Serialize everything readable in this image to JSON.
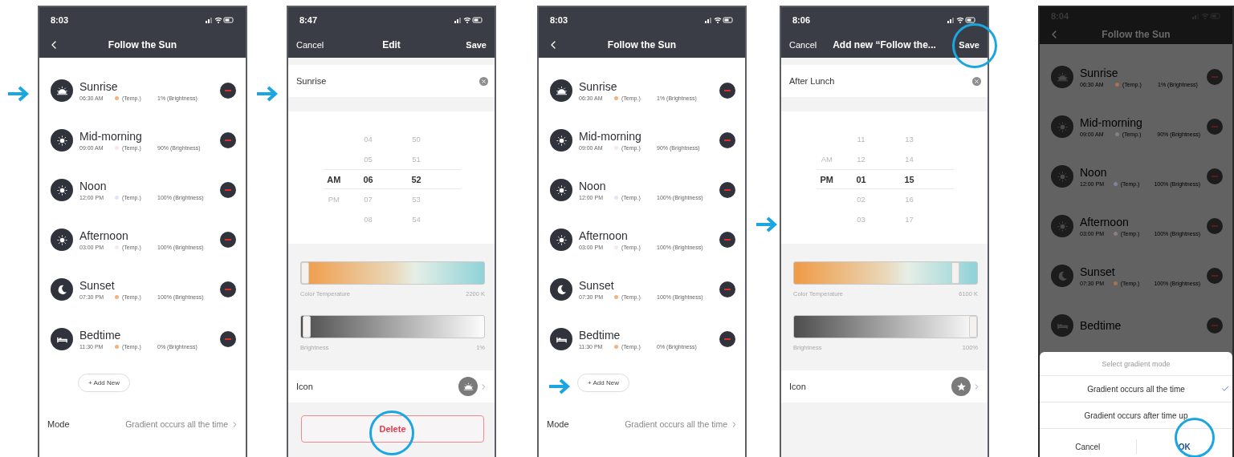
{
  "screens": [
    {
      "kind": "list",
      "dimmed": false,
      "status_time": "8:03",
      "title": "Follow the Sun",
      "items": [
        {
          "kind": "sunrise",
          "name": "Sunrise",
          "time": "06:30 AM",
          "temp": "(Temp.)",
          "color": "#f6b27c",
          "brightness": "1% (Brightness)"
        },
        {
          "kind": "sun",
          "name": "Mid-morning",
          "time": "09:00 AM",
          "temp": "(Temp.)",
          "color": "#f7e8e8",
          "brightness": "90% (Brightness)"
        },
        {
          "kind": "sun",
          "name": "Noon",
          "time": "12:00 PM",
          "temp": "(Temp.)",
          "color": "#dfe7f6",
          "brightness": "100% (Brightness)"
        },
        {
          "kind": "sun",
          "name": "Afternoon",
          "time": "03:00 PM",
          "temp": "(Temp.)",
          "color": "#f7ebe8",
          "brightness": "100% (Brightness)"
        },
        {
          "kind": "moon",
          "name": "Sunset",
          "time": "07:30 PM",
          "temp": "(Temp.)",
          "color": "#f6b27c",
          "brightness": "100% (Brightness)"
        },
        {
          "kind": "bed",
          "name": "Bedtime",
          "time": "11:30 PM",
          "temp": "(Temp.)",
          "color": "#f6b27c",
          "brightness": "0% (Brightness)"
        }
      ],
      "add_button": "+ Add New",
      "mode": {
        "label": "Mode",
        "value": "Gradient occurs all the time"
      }
    },
    {
      "kind": "edit",
      "status_time": "8:47",
      "cancel": "Cancel",
      "title": "Edit",
      "save": "Save",
      "name": "Sunrise",
      "picker": [
        {
          "hour": "04",
          "minute": "50",
          "selected": false
        },
        {
          "hour": "05",
          "minute": "51",
          "selected": false
        },
        {
          "period": "AM",
          "hour": "06",
          "minute": "52",
          "selected": true
        },
        {
          "period": "PM",
          "hour": "07",
          "minute": "53",
          "selected": false
        },
        {
          "hour": "08",
          "minute": "54",
          "selected": false
        }
      ],
      "temperature": {
        "label": "Color Temperature",
        "reading": "2200 K",
        "level": 0
      },
      "brightness": {
        "label": "Brightness",
        "reading": "1%",
        "level": 0.01
      },
      "icon_row": {
        "label": "Icon",
        "kind": "sunrise"
      },
      "delete": "Delete"
    },
    {
      "kind": "list",
      "dimmed": false,
      "status_time": "8:03",
      "title": "Follow the Sun",
      "items": [
        {
          "kind": "sunrise",
          "name": "Sunrise",
          "time": "06:30 AM",
          "temp": "(Temp.)",
          "color": "#f6b27c",
          "brightness": "1% (Brightness)"
        },
        {
          "kind": "sun",
          "name": "Mid-morning",
          "time": "09:00 AM",
          "temp": "(Temp.)",
          "color": "#f7e8e8",
          "brightness": "90% (Brightness)"
        },
        {
          "kind": "sun",
          "name": "Noon",
          "time": "12:00 PM",
          "temp": "(Temp.)",
          "color": "#dfe7f6",
          "brightness": "100% (Brightness)"
        },
        {
          "kind": "sun",
          "name": "Afternoon",
          "time": "03:00 PM",
          "temp": "(Temp.)",
          "color": "#f7ebe8",
          "brightness": "100% (Brightness)"
        },
        {
          "kind": "moon",
          "name": "Sunset",
          "time": "07:30 PM",
          "temp": "(Temp.)",
          "color": "#f6b27c",
          "brightness": "100% (Brightness)"
        },
        {
          "kind": "bed",
          "name": "Bedtime",
          "time": "11:30 PM",
          "temp": "(Temp.)",
          "color": "#f6b27c",
          "brightness": "0% (Brightness)"
        }
      ],
      "add_button": "+ Add New",
      "mode": {
        "label": "Mode",
        "value": "Gradient occurs all the time"
      }
    },
    {
      "kind": "edit",
      "status_time": "8:06",
      "cancel": "Cancel",
      "title": "Add new “Follow the...",
      "save": "Save",
      "name": "After Lunch",
      "picker": [
        {
          "hour": "11",
          "minute": "13",
          "selected": false
        },
        {
          "period": "AM",
          "hour": "12",
          "minute": "14",
          "selected": false
        },
        {
          "period": "PM",
          "hour": "01",
          "minute": "15",
          "selected": true
        },
        {
          "hour": "02",
          "minute": "16",
          "selected": false
        },
        {
          "hour": "03",
          "minute": "17",
          "selected": false
        }
      ],
      "temperature": {
        "label": "Color Temperature",
        "reading": "6100 K",
        "level": 0.9
      },
      "brightness": {
        "label": "Brightness",
        "reading": "100%",
        "level": 1
      },
      "icon_row": {
        "label": "Icon",
        "kind": "star"
      }
    },
    {
      "kind": "list",
      "dimmed": true,
      "status_time": "8:04",
      "title": "Follow the Sun",
      "items": [
        {
          "kind": "sunrise",
          "name": "Sunrise",
          "time": "06:30 AM",
          "temp": "(Temp.)",
          "color": "#a5734f",
          "brightness": "1% (Brightness)"
        },
        {
          "kind": "sun",
          "name": "Mid-morning",
          "time": "09:00 AM",
          "temp": "(Temp.)",
          "color": "#8a7e7e",
          "brightness": "90% (Brightness)"
        },
        {
          "kind": "sun",
          "name": "Noon",
          "time": "12:00 PM",
          "temp": "(Temp.)",
          "color": "#7e8496",
          "brightness": "100% (Brightness)"
        },
        {
          "kind": "sun",
          "name": "Afternoon",
          "time": "03:00 PM",
          "temp": "(Temp.)",
          "color": "#8a7e7e",
          "brightness": "100% (Brightness)"
        },
        {
          "kind": "moon",
          "name": "Sunset",
          "time": "07:30 PM",
          "temp": "(Temp.)",
          "color": "#a5734f",
          "brightness": "100% (Brightness)"
        },
        {
          "kind": "bed",
          "name": "Bedtime"
        }
      ],
      "sheet": {
        "title": "Select gradient mode",
        "options": [
          {
            "label": "Gradient occurs all the time",
            "selected": true
          },
          {
            "label": "Gradient occurs after time up",
            "selected": false
          }
        ],
        "cancel": "Cancel",
        "ok": "OK"
      }
    }
  ]
}
